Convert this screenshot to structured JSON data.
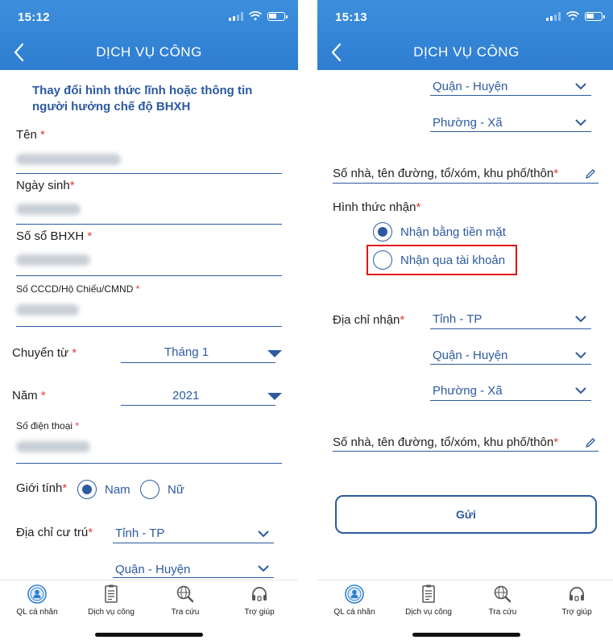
{
  "status_left": {
    "time": "15:12"
  },
  "status_right": {
    "time": "15:13"
  },
  "header": {
    "title": "DỊCH VỤ CÔNG"
  },
  "left": {
    "form_title": "Thay đổi hình thức lĩnh hoặc thông tin người hưởng chế độ BHXH",
    "fields": {
      "name_label": "Tên",
      "dob_label": "Ngày sinh",
      "bhxh_label": "Số sổ BHXH",
      "id_label": "Số CCCD/Hộ Chiếu/CMND",
      "from_label": "Chuyển từ",
      "from_value": "Tháng 1",
      "year_label": "Năm",
      "year_value": "2021",
      "phone_label": "Số điện thoại",
      "gender_label": "Giới tính",
      "gender_male": "Nam",
      "gender_female": "Nữ",
      "address_label": "Địa chỉ cư trú",
      "province_value": "Tỉnh - TP",
      "district_value": "Quận - Huyện"
    },
    "required_mark": "*"
  },
  "right": {
    "district_top": "Quận - Huyện",
    "ward_top": "Phường - Xã",
    "street_label_1": "Số nhà, tên đường, tổ/xóm, khu phố/thôn",
    "receive_method_label": "Hình thức nhận",
    "option_cash": "Nhận bằng tiền mặt",
    "option_account": "Nhận qua tài khoản",
    "receive_address_label": "Địa chỉ nhận",
    "province_value": "Tỉnh - TP",
    "district_value": "Quận - Huyện",
    "ward_value": "Phường - Xã",
    "street_label_2": "Số nhà, tên đường, tổ/xóm, khu phố/thôn",
    "submit": "Gửi",
    "required_mark": "*"
  },
  "tabs": [
    {
      "label": "QL cá nhân",
      "icon": "person-circle-icon"
    },
    {
      "label": "Dịch vụ công",
      "icon": "document-icon"
    },
    {
      "label": "Tra cứu",
      "icon": "globe-search-icon"
    },
    {
      "label": "Trợ giúp",
      "icon": "headset-icon"
    }
  ],
  "colors": {
    "header": "#2e7dd1",
    "primary": "#2c5aa0",
    "required": "#e53935",
    "highlight": "#e0111b"
  }
}
